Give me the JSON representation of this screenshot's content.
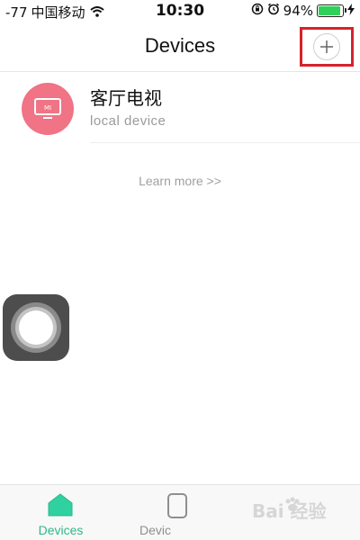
{
  "status_bar": {
    "signal": "-77",
    "carrier": "中国移动",
    "time": "10:30",
    "battery_percent": "94%",
    "battery_level": 0.94,
    "icons": [
      "wifi-icon",
      "rotation-lock-icon",
      "alarm-icon",
      "battery-icon",
      "charging-icon"
    ]
  },
  "nav": {
    "title": "Devices",
    "add_icon": "plus-icon",
    "highlight_color": "#d6222a"
  },
  "devices": [
    {
      "name": "客厅电视",
      "subtitle": "local  device",
      "icon": "mi-tv-icon",
      "avatar_color": "#f07386",
      "badge": "MI"
    }
  ],
  "learn_more": "Learn more >>",
  "tabs": [
    {
      "label": "Devices",
      "icon": "home-icon",
      "active": true,
      "color": "#2fb88a"
    },
    {
      "label": "Devic",
      "icon": "device-icon",
      "active": false,
      "color": "#8f8f8f"
    }
  ],
  "watermark": {
    "text": "Bai 经验",
    "icon": "paw-icon"
  },
  "colors": {
    "accent": "#2fb88a",
    "avatar": "#f07386",
    "battery": "#2fd159"
  }
}
